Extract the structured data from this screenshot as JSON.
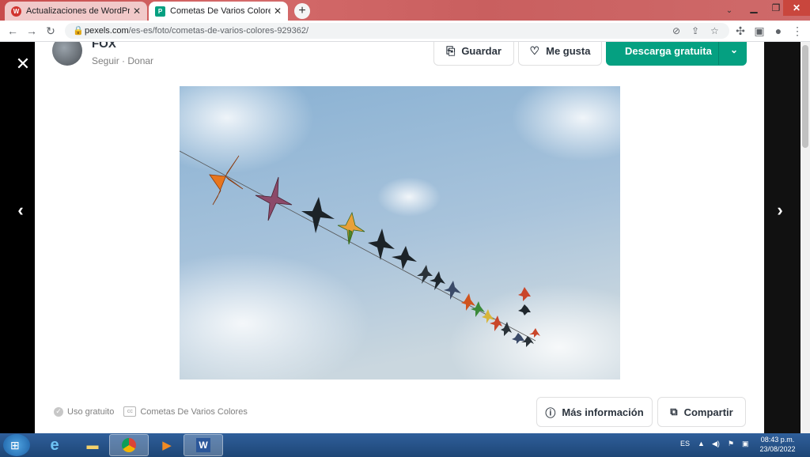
{
  "browser": {
    "tabs": [
      {
        "title": "Actualizaciones de WordPress ‹ D",
        "active": false,
        "favicon": "wordpress-icon"
      },
      {
        "title": "Cometas De Varios Colores · Foto",
        "active": true,
        "favicon": "pexels-icon"
      }
    ],
    "new_tab": "+",
    "url_host": "pexels.com",
    "url_path": "/es-es/foto/cometas-de-varios-colores-929362/"
  },
  "author": {
    "name": "FOX",
    "actions": "Seguir · Donar"
  },
  "actions": {
    "save": "Guardar",
    "like": "Me gusta",
    "download": "Descarga gratuita"
  },
  "photo": {
    "alt": "Cometas De Varios Colores"
  },
  "footer": {
    "license": "Uso gratuito",
    "title": "Cometas De Varios Colores",
    "more_info": "Más información",
    "share": "Compartir"
  },
  "taskbar": {
    "lang": "ES",
    "time": "08:43 p.m.",
    "date": "23/08/2022"
  },
  "colors": {
    "accent": "#05a081",
    "sky_top": "#8fb3d2",
    "sky_bottom": "#c6d6e0"
  }
}
